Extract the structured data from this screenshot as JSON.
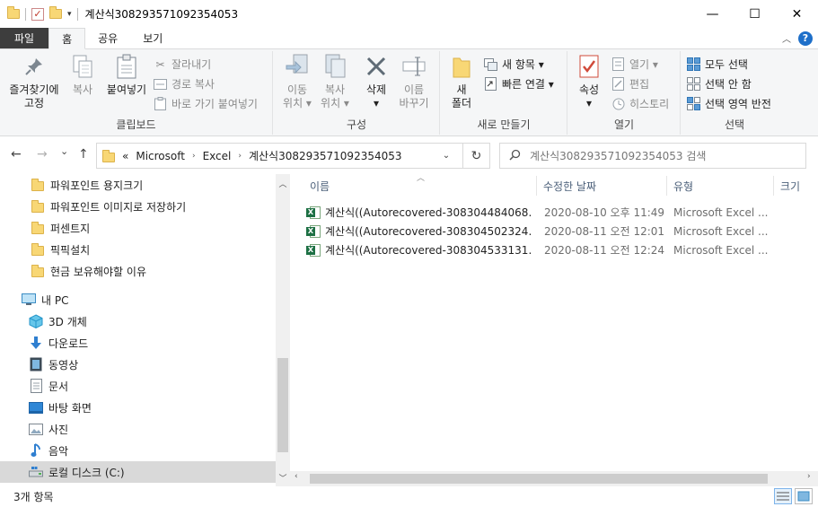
{
  "window": {
    "title": "계산식308293571092354053",
    "min_glyph": "—",
    "max_glyph": "☐",
    "close_glyph": "✕"
  },
  "ribbon_tabs": {
    "file": "파일",
    "home": "홈",
    "share": "공유",
    "view": "보기",
    "help": "?"
  },
  "ribbon": {
    "clipboard": {
      "label": "클립보드",
      "pin": "즐겨찾기에\n고정",
      "copy": "복사",
      "paste": "붙여넣기",
      "cut": "잘라내기",
      "copy_path": "경로 복사",
      "paste_shortcut": "바로 가기 붙여넣기"
    },
    "organize": {
      "label": "구성",
      "move_to": "이동\n위치 ▾",
      "copy_to": "복사\n위치 ▾",
      "delete": "삭제\n▾",
      "rename": "이름\n바꾸기"
    },
    "new": {
      "label": "새로 만들기",
      "new_folder": "새\n폴더",
      "new_item": "새 항목 ▾",
      "easy_access": "빠른 연결 ▾"
    },
    "open": {
      "label": "열기",
      "properties": "속성\n▾",
      "open": "열기 ▾",
      "edit": "편집",
      "history": "히스토리"
    },
    "select": {
      "label": "선택",
      "select_all": "모두 선택",
      "select_none": "선택 안 함",
      "invert": "선택 영역 반전"
    }
  },
  "nav": {
    "back": "←",
    "forward": "→",
    "recent": "⌄",
    "up": "↑",
    "breadcrumb": [
      "Microsoft",
      "Excel",
      "계산식308293571092354053"
    ],
    "breadcrumb_overflow": "«",
    "refresh": "↻",
    "search_placeholder": "계산식308293571092354053 검색"
  },
  "navpane": {
    "quick_access": [
      {
        "label": "파워포인트 용지크기",
        "icon": "folder-icon"
      },
      {
        "label": "파워포인트 이미지로 저장하기",
        "icon": "folder-icon"
      },
      {
        "label": "퍼센트지",
        "icon": "folder-icon"
      },
      {
        "label": "픽픽설치",
        "icon": "folder-icon"
      },
      {
        "label": "현금 보유해야할 이유",
        "icon": "folder-icon"
      }
    ],
    "this_pc": "내 PC",
    "pc_items": [
      {
        "label": "3D 개체",
        "icon": "cube-icon"
      },
      {
        "label": "다운로드",
        "icon": "download-icon"
      },
      {
        "label": "동영상",
        "icon": "video-icon"
      },
      {
        "label": "문서",
        "icon": "document-icon"
      },
      {
        "label": "바탕 화면",
        "icon": "desktop-icon"
      },
      {
        "label": "사진",
        "icon": "picture-icon"
      },
      {
        "label": "음악",
        "icon": "music-icon"
      },
      {
        "label": "로컬 디스크 (C:)",
        "icon": "drive-icon"
      }
    ]
  },
  "columns": {
    "name": "이름",
    "date": "수정한 날짜",
    "type": "유형",
    "size": "크기"
  },
  "files": [
    {
      "name": "계산식((Autorecovered-308304484068...",
      "date": "2020-08-10 오후 11:49",
      "type": "Microsoft Excel ..."
    },
    {
      "name": "계산식((Autorecovered-308304502324...",
      "date": "2020-08-11 오전 12:01",
      "type": "Microsoft Excel ..."
    },
    {
      "name": "계산식((Autorecovered-308304533131...",
      "date": "2020-08-11 오전 12:24",
      "type": "Microsoft Excel ..."
    }
  ],
  "status": {
    "item_count": "3개 항목"
  },
  "colors": {
    "file_tab": "#3d3d3d",
    "selection": "#d9d9d9",
    "folder": "#f8d775",
    "excel": "#1d7044",
    "header_text": "#4c607a"
  }
}
